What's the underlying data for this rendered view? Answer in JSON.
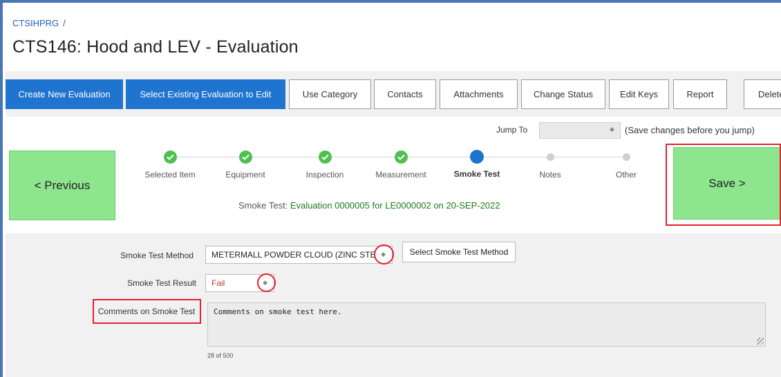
{
  "header": {
    "breadcrumb": "CTSIHPRG",
    "breadcrumb_sep": "/",
    "title": "CTS146: Hood and LEV - Evaluation"
  },
  "toolbar": {
    "buttons": [
      {
        "label": "Create New Evaluation"
      },
      {
        "label": "Select Existing Evaluation to Edit"
      },
      {
        "label": "Use Category"
      },
      {
        "label": "Contacts"
      },
      {
        "label": "Attachments"
      },
      {
        "label": "Change Status"
      },
      {
        "label": "Edit Keys"
      },
      {
        "label": "Report"
      },
      {
        "label": "Delete"
      }
    ]
  },
  "jump": {
    "label": "Jump To",
    "value": "",
    "note": "(Save changes before you jump)"
  },
  "nav": {
    "previous": "< Previous",
    "save": "Save >"
  },
  "steps": [
    {
      "label": "Selected Item",
      "state": "done"
    },
    {
      "label": "Equipment",
      "state": "done"
    },
    {
      "label": "Inspection",
      "state": "done"
    },
    {
      "label": "Measurement",
      "state": "done"
    },
    {
      "label": "Smoke Test",
      "state": "current"
    },
    {
      "label": "Notes",
      "state": "todo"
    },
    {
      "label": "Other",
      "state": "todo"
    }
  ],
  "status": {
    "prefix": "Smoke Test:",
    "value": "Evaluation 0000005 for LE0000002 on 20-SEP-2022"
  },
  "form": {
    "method_label": "Smoke Test Method",
    "method_value": "METERMALL POWDER CLOUD (ZINC STE",
    "select_method_button": "Select Smoke Test Method",
    "result_label": "Smoke Test Result",
    "result_value": "Fail",
    "comments_label": "Comments on Smoke Test",
    "comments_value": "Comments on smoke test here.",
    "char_count": "28 of 500"
  },
  "colors": {
    "primary": "#1f74d0",
    "nav_green": "#8de68d",
    "highlight_red": "#e0222e",
    "done_green": "#4fc04f",
    "fail_red": "#c0392b"
  }
}
